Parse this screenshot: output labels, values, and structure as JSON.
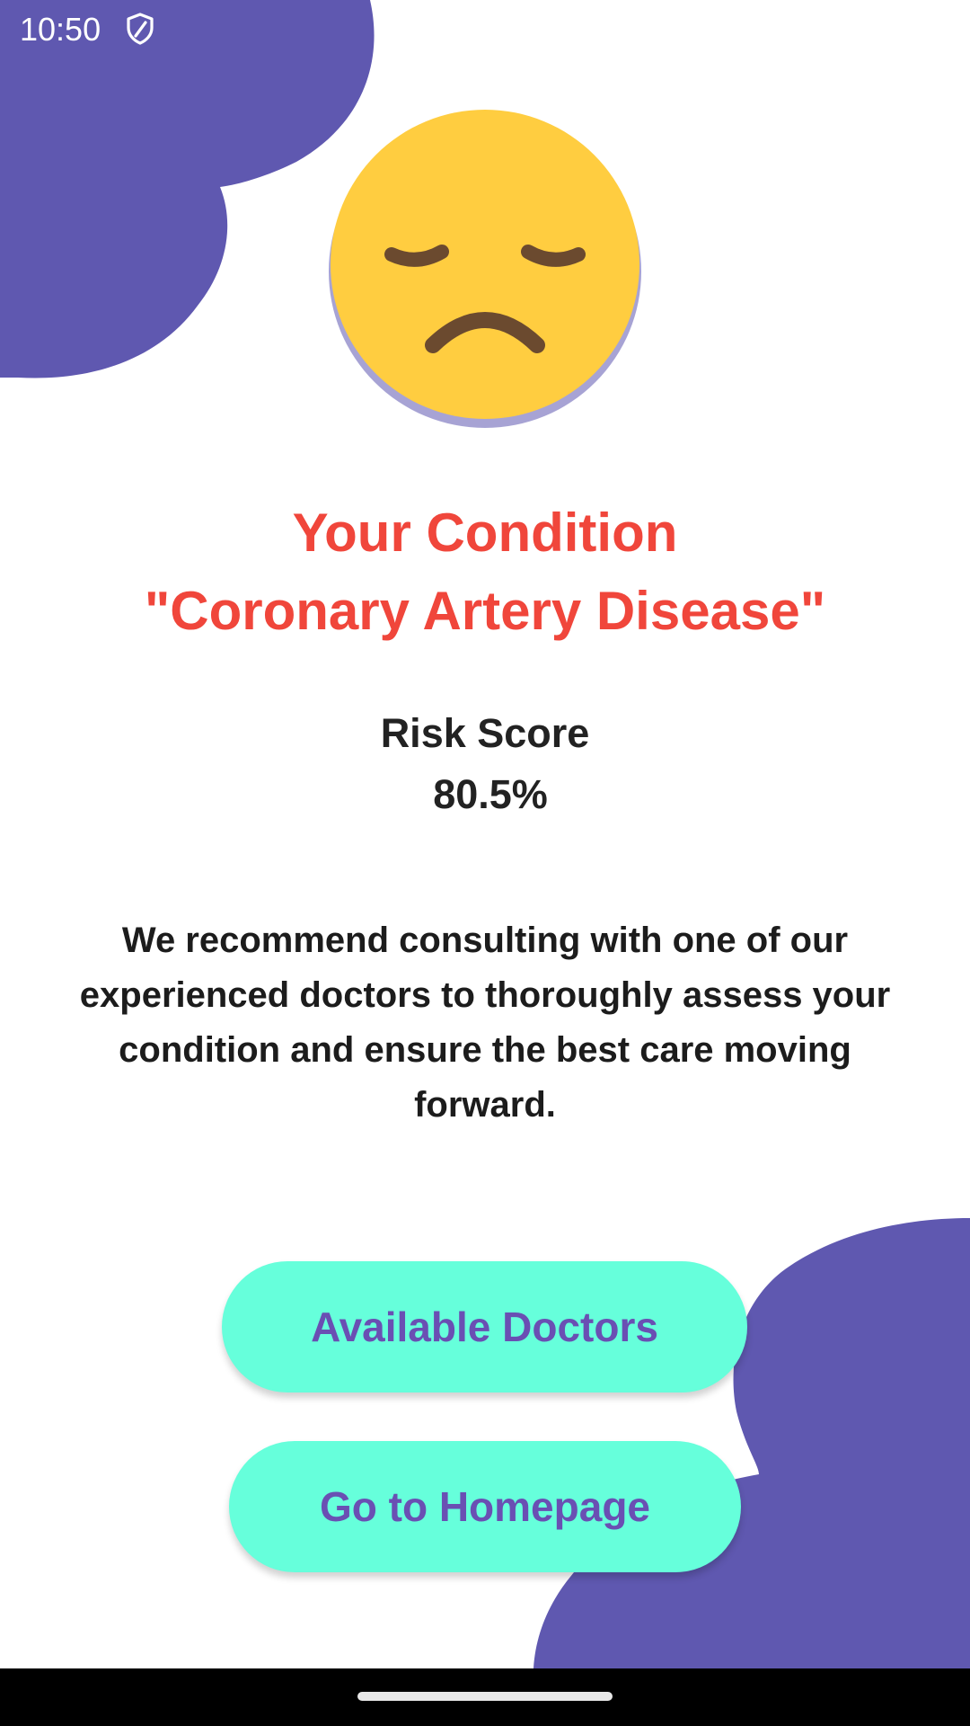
{
  "status_bar": {
    "time": "10:50",
    "icons": [
      "shield-icon"
    ]
  },
  "result": {
    "emoji": "sad-face-icon",
    "title_line1": "Your Condition",
    "title_line2": "\"Coronary Artery Disease\"",
    "risk_label": "Risk Score",
    "risk_value": "80.5%",
    "recommendation": "We recommend consulting with one of our experienced doctors to thoroughly assess your condition and ensure the best care moving forward."
  },
  "actions": {
    "available_doctors_label": "Available Doctors",
    "homepage_label": "Go to Homepage"
  },
  "colors": {
    "accent_purple": "#5f58b0",
    "title_red": "#f0463b",
    "button_mint": "#66ffdb",
    "button_text": "#6a4fb3",
    "emoji_yellow": "#ffcd40"
  }
}
